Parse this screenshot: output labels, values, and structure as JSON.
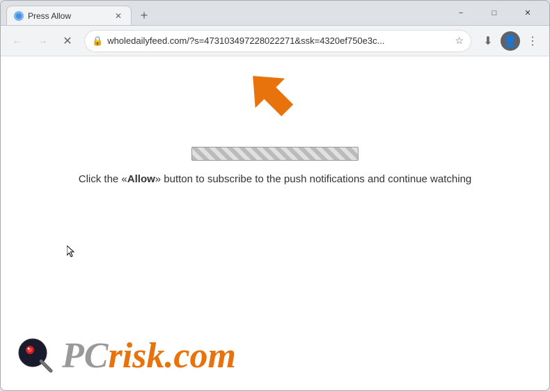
{
  "window": {
    "title": "Press Allow",
    "url": "wholedailyfeed.com/?s=473103497228022271&ssk=4320ef750e3c...",
    "new_tab_label": "+",
    "controls": {
      "minimize": "−",
      "maximize": "□",
      "close": "✕"
    }
  },
  "nav": {
    "back_icon": "←",
    "forward_icon": "→",
    "refresh_icon": "✕",
    "lock_icon": "🔒",
    "bookmark_icon": "☆",
    "menu_icon": "⋮",
    "profile_icon": "👤",
    "download_icon": "⬇"
  },
  "page": {
    "subscribe_text_before": "Click the «",
    "subscribe_text_allow": "Allow",
    "subscribe_text_after": "» button to subscribe to the push notifications and continue watching",
    "progress_bar_label": "loading progress"
  },
  "logo": {
    "pc_text": "PC",
    "risk_text": "risk",
    "dot_com": ".com"
  },
  "colors": {
    "arrow_orange": "#e8720c",
    "text_dark": "#333333",
    "accent_orange": "#e8720c"
  }
}
